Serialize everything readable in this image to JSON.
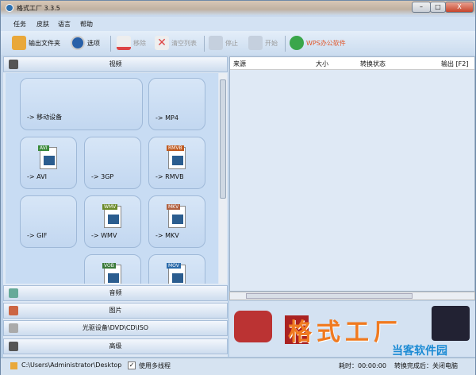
{
  "window": {
    "title": "格式工厂 3.3.5",
    "minimize": "–",
    "maximize": "□",
    "close": "X"
  },
  "menu": [
    "任务",
    "皮肤",
    "语言",
    "帮助"
  ],
  "toolbar": {
    "output_folder": "输出文件夹",
    "options": "选项",
    "remove": "移除",
    "clear_list": "清空列表",
    "stop": "停止",
    "start": "开始",
    "wps": "WPS办公软件"
  },
  "categories": {
    "video": "视频",
    "audio": "音频",
    "picture": "图片",
    "rom": "光驱设备\\DVD\\CD\\ISO",
    "advanced": "高级"
  },
  "tiles": [
    {
      "label": "-> 移动设备",
      "badge": ""
    },
    {
      "label": "-> MP4",
      "badge": ""
    },
    {
      "label": "-> AVI",
      "badge": "AVI"
    },
    {
      "label": "-> 3GP",
      "badge": ""
    },
    {
      "label": "-> RMVB",
      "badge": "RMVB"
    },
    {
      "label": "-> GIF",
      "badge": ""
    },
    {
      "label": "-> WMV",
      "badge": "WMV"
    },
    {
      "label": "-> MKV",
      "badge": "MKV"
    },
    {
      "label": "",
      "badge": "VOB"
    },
    {
      "label": "",
      "badge": "MOV"
    }
  ],
  "list": {
    "columns": [
      "来源",
      "大小",
      "转换状态",
      "输出 [F2]"
    ]
  },
  "banner": {
    "logo_text": "格式工厂",
    "watermark": "当客软件园"
  },
  "status": {
    "path": "C:\\Users\\Administrator\\Desktop",
    "multithread": "使用多线程",
    "elapsed": "耗时：00:00:00",
    "after": "转换完成后：关闭电脑"
  },
  "colors": {
    "accent": "#f07a20",
    "wps": "#e0562a"
  }
}
